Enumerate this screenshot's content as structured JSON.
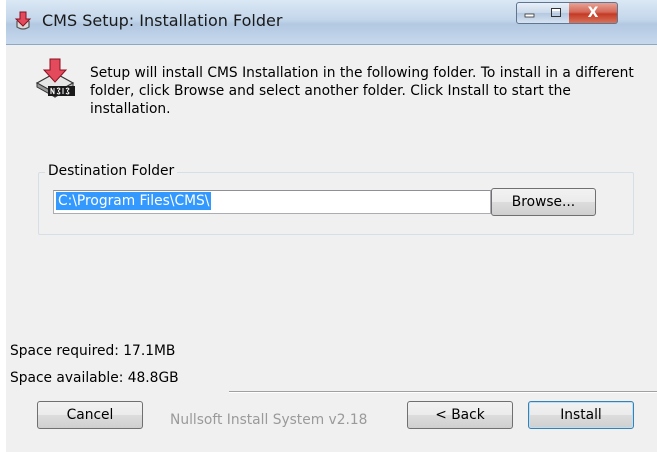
{
  "window": {
    "title": "CMS Setup: Installation Folder",
    "controls": {
      "minimize": "minimize",
      "maximize": "maximize",
      "close": "X"
    }
  },
  "description": "Setup will install CMS Installation in the following folder. To install in a different folder, click Browse and select another folder. Click Install to start the installation.",
  "destination": {
    "group_label": "Destination Folder",
    "path_value": "C:\\Program Files\\CMS\\",
    "browse_label": "Browse..."
  },
  "space": {
    "required": "Space required: 17.1MB",
    "available": "Space available: 48.8GB"
  },
  "branding": "Nullsoft Install System v2.18",
  "buttons": {
    "cancel": "Cancel",
    "back": "< Back",
    "install": "Install"
  },
  "colors": {
    "selection": "#3399ff",
    "dialog_bg": "#f0f0f0",
    "close_button": "#c43a25"
  },
  "icons": {
    "window": "installer-arrow-icon",
    "header": "nsis-installer-icon"
  }
}
